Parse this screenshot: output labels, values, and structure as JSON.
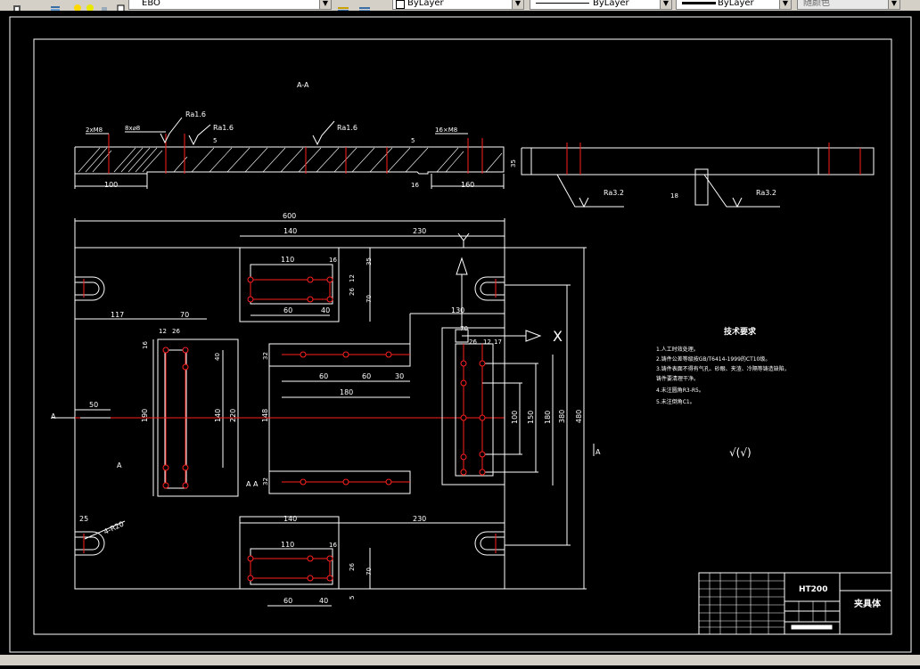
{
  "toolbar": {
    "layer_name": "EBO",
    "color_value": "ByLayer",
    "linetype_value": "ByLayer",
    "lineweight_value": "ByLayer",
    "plotstyle_value": "随颜色"
  },
  "drawing": {
    "section_label": "A-A",
    "roughness_1": "Ra1.6",
    "roughness_2": "Ra1.6",
    "roughness_3": "Ra1.6",
    "roughness_4": "Ra3.2",
    "roughness_5": "Ra3.2",
    "dim_2xm8": "2xM8",
    "dim_8x8": "8x⌀8",
    "dim_16xm8": "16×M8",
    "dim_100": "100",
    "dim_160": "160",
    "dim_35": "35",
    "dim_16": "16",
    "dim_18": "18",
    "dim_5a": "5",
    "dim_5b": "5",
    "dim_600": "600",
    "dim_230a": "230",
    "dim_140a": "140",
    "dim_110a": "110",
    "dim_16a": "16",
    "dim_35b": "35",
    "dim_12a": "12",
    "dim_26a": "26",
    "dim_70a": "70",
    "dim_60a": "60",
    "dim_40a": "40",
    "dim_117": "117",
    "dim_70b": "70",
    "dim_12b": "12",
    "dim_26b": "26",
    "dim_16b": "16",
    "dim_40b": "40",
    "dim_50": "50",
    "dim_190": "190",
    "dim_140b": "140",
    "dim_220": "220",
    "dim_130": "130",
    "dim_70c": "70",
    "dim_26c": "26",
    "dim_12c": "12",
    "dim_17": "17",
    "dim_32": "32",
    "dim_60b": "60",
    "dim_60c": "60",
    "dim_30": "30",
    "dim_180": "180",
    "dim_148": "148",
    "dim_32b": "32",
    "dim_100b": "100",
    "dim_150": "150",
    "dim_180b": "180",
    "dim_380": "380",
    "dim_480": "480",
    "dim_25": "25",
    "dim_r4": "4-R20",
    "dim_140c": "140",
    "dim_230b": "230",
    "dim_110b": "110",
    "dim_16c": "16",
    "dim_60d": "60",
    "dim_40c": "40",
    "dim_5c": "5",
    "dim_26d": "26",
    "dim_70d": "70",
    "label_a1": "A",
    "label_a2": "A",
    "label_a3": "A",
    "label_a4": "A",
    "label_a5": "A",
    "label_x": "X",
    "tech_title": "技术要求",
    "tech_1": "1.人工时效处理。",
    "tech_2": "2.铸件公差等级按GB/T6414-1999的CT10级。",
    "tech_3": "3.铸件表面不得有气孔、砂眼、夹渣、冷隔等铸造缺陷，",
    "tech_3b": "铸件要清理干净。",
    "tech_4": "4.未注圆角R3-R5。",
    "tech_5": "5.未注倒角C1。",
    "rough_other": "√(√)",
    "title_material": "HT200",
    "title_name": "夹具体"
  },
  "colors": {
    "background": "#000000",
    "line_white": "#ffffff",
    "line_red": "#ff2020",
    "toolbar": "#d4d0c8"
  }
}
